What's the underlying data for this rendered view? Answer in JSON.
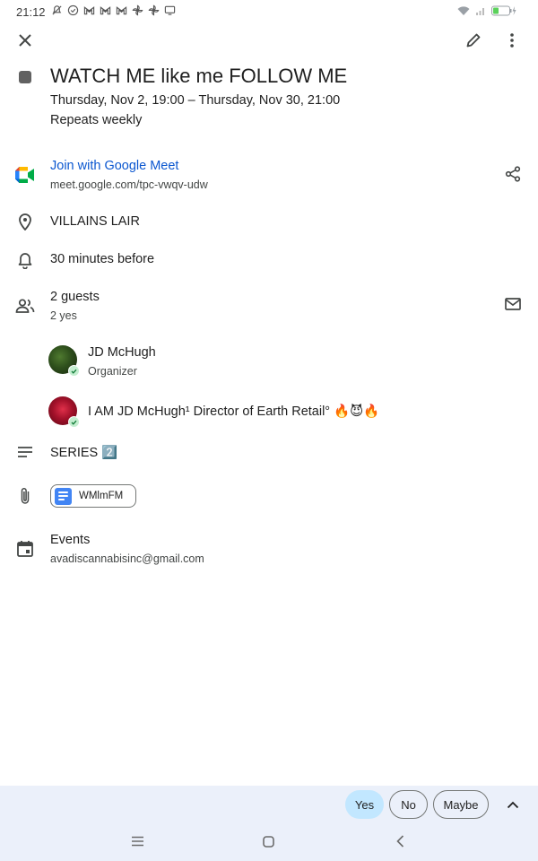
{
  "status_bar": {
    "time": "21:12",
    "notification_icons": [
      "mute-icon",
      "check-circle-icon",
      "gmail-icon",
      "gmail-icon",
      "gmail-icon",
      "pinwheel-icon",
      "pinwheel-icon",
      "screen-icon"
    ],
    "system_icons": [
      "wifi-icon",
      "signal-icon",
      "battery-charging-icon"
    ]
  },
  "toolbar": {
    "close_icon": "close-icon",
    "edit_icon": "pencil-icon",
    "more_icon": "more-vert-icon"
  },
  "event": {
    "color": "#616161",
    "title": "WATCH ME like me FOLLOW ME",
    "datetime": "Thursday, Nov 2, 19:00 – Thursday, Nov 30, 21:00",
    "recurrence": "Repeats weekly"
  },
  "meet": {
    "link_label": "Join with Google Meet",
    "url": "meet.google.com/tpc-vwqv-udw",
    "share_icon": "share-icon"
  },
  "location": "VILLAINS LAIR",
  "reminder": "30 minutes before",
  "guests": {
    "count_label": "2 guests",
    "responses": "2 yes",
    "list": [
      {
        "name": "JD McHugh",
        "role": "Organizer"
      },
      {
        "name": "I AM JD McHugh¹ Director of Earth Retail° 🔥😈🔥",
        "role": ""
      }
    ]
  },
  "description": "SERIES 2️⃣",
  "attachment": {
    "name": "WMlmFM"
  },
  "calendar": {
    "name": "Events",
    "account": "avadiscannabisinc@gmail.com"
  },
  "rsvp": {
    "yes": "Yes",
    "no": "No",
    "maybe": "Maybe",
    "selected": "Yes"
  },
  "colors": {
    "link": "#0b57d0",
    "rsvp_bar": "#ebf0fa",
    "yes_selected": "#c2e7ff"
  }
}
